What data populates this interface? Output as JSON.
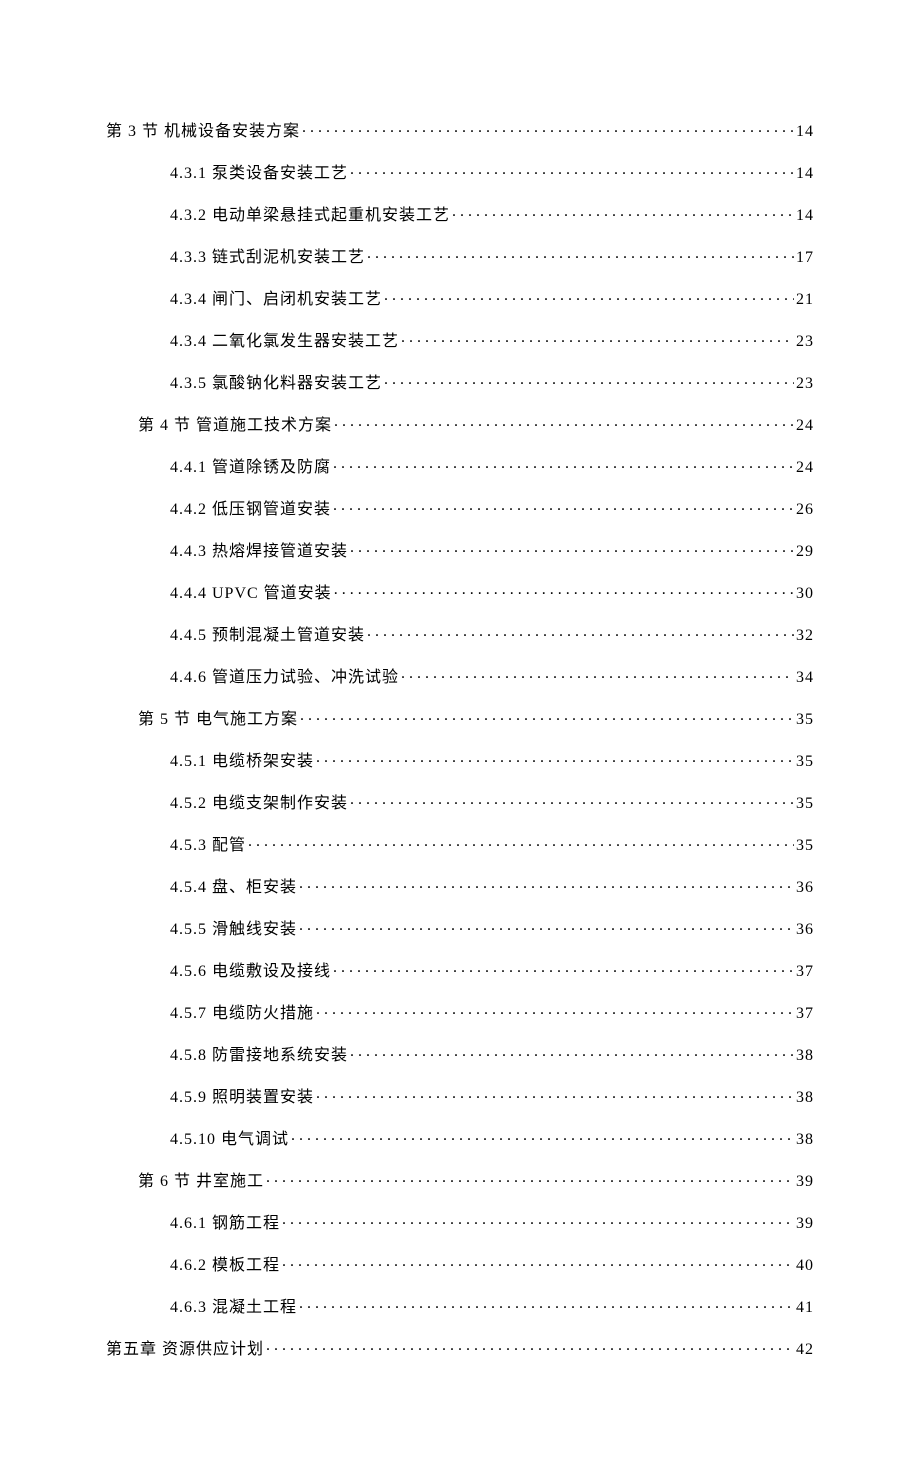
{
  "toc": [
    {
      "indent": 0,
      "label": "第 3 节  机械设备安装方案",
      "page": "14"
    },
    {
      "indent": 2,
      "label": "4.3.1 泵类设备安装工艺 ",
      "page": "14"
    },
    {
      "indent": 2,
      "label": "4.3.2 电动单梁悬挂式起重机安装工艺 ",
      "page": "14"
    },
    {
      "indent": 2,
      "label": "4.3.3 链式刮泥机安装工艺 ",
      "page": "17"
    },
    {
      "indent": 2,
      "label": "4.3.4 闸门、启闭机安装工艺 ",
      "page": "21"
    },
    {
      "indent": 2,
      "label": "4.3.4 二氧化氯发生器安装工艺 ",
      "page": "23"
    },
    {
      "indent": 2,
      "label": "4.3.5 氯酸钠化料器安装工艺 ",
      "page": "23"
    },
    {
      "indent": 1,
      "label": "第 4 节   管道施工技术方案 ",
      "page": "24"
    },
    {
      "indent": 2,
      "label": "4.4.1   管道除锈及防腐",
      "page": "24"
    },
    {
      "indent": 2,
      "label": "4.4.2   低压钢管道安装",
      "page": "26"
    },
    {
      "indent": 2,
      "label": "4.4.3   热熔焊接管道安装",
      "page": "29"
    },
    {
      "indent": 2,
      "label": "4.4.4   UPVC 管道安装 ",
      "page": "30"
    },
    {
      "indent": 2,
      "label": "4.4.5   预制混凝土管道安装",
      "page": "32"
    },
    {
      "indent": 2,
      "label": "4.4.6   管道压力试验、冲洗试验",
      "page": "34"
    },
    {
      "indent": 1,
      "label": "第 5 节  电气施工方案 ",
      "page": "35"
    },
    {
      "indent": 2,
      "label": "4.5.1 电缆桥架安装 ",
      "page": "35"
    },
    {
      "indent": 2,
      "label": "4.5.2 电缆支架制作安装 ",
      "page": "35"
    },
    {
      "indent": 2,
      "label": "4.5.3 配管 ",
      "page": "35"
    },
    {
      "indent": 2,
      "label": "4.5.4 盘、柜安装 ",
      "page": "36"
    },
    {
      "indent": 2,
      "label": "4.5.5 滑触线安装 ",
      "page": "36"
    },
    {
      "indent": 2,
      "label": "4.5.6 电缆敷设及接线 ",
      "page": "37"
    },
    {
      "indent": 2,
      "label": "4.5.7 电缆防火措施 ",
      "page": "37"
    },
    {
      "indent": 2,
      "label": "4.5.8 防雷接地系统安装 ",
      "page": "38"
    },
    {
      "indent": 2,
      "label": "4.5.9 照明装置安装 ",
      "page": "38"
    },
    {
      "indent": 2,
      "label": "4.5.10 电气调试 ",
      "page": "38"
    },
    {
      "indent": 1,
      "label": "第 6 节   井室施工 ",
      "page": "39"
    },
    {
      "indent": 2,
      "label": "4.6.1 钢筋工程 ",
      "page": "39"
    },
    {
      "indent": 2,
      "label": "4.6.2 模板工程 ",
      "page": "40"
    },
    {
      "indent": 2,
      "label": "4.6.3 混凝土工程 ",
      "page": "41"
    },
    {
      "indent": 0,
      "label": "第五章    资源供应计划",
      "page": "42"
    }
  ]
}
